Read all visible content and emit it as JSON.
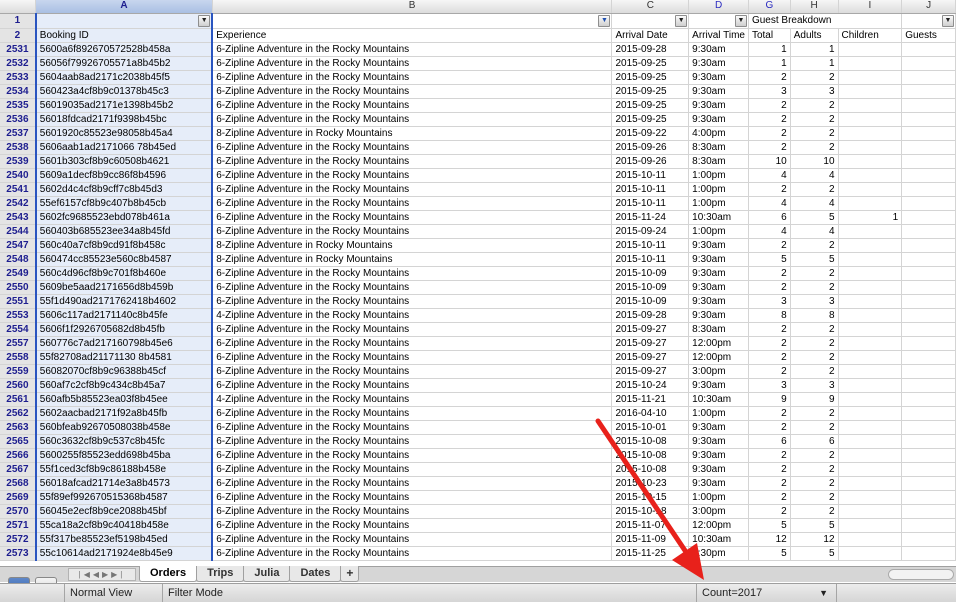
{
  "columns": {
    "row_header_top": "",
    "letters": [
      "A",
      "B",
      "C",
      "D",
      "G",
      "H",
      "I",
      "J"
    ],
    "row1_group": "Guest Breakdown",
    "headers": [
      "Booking ID",
      "Experience",
      "Arrival Date",
      "Arrival Time",
      "Total",
      "Adults",
      "Children",
      "Guests"
    ]
  },
  "header_row_numbers": [
    "1",
    "2"
  ],
  "rows": [
    [
      "2531",
      "5600a6f892670572528b458a",
      "6-Zipline Adventure in the Rocky Mountains",
      "2015-09-28",
      "9:30am",
      "1",
      "1",
      ""
    ],
    [
      "2532",
      "56056f79926705571a8b45b2",
      "6-Zipline Adventure in the Rocky Mountains",
      "2015-09-25",
      "9:30am",
      "1",
      "1",
      ""
    ],
    [
      "2533",
      "5604aab8ad2171c2038b45f5",
      "6-Zipline Adventure in the Rocky Mountains",
      "2015-09-25",
      "9:30am",
      "2",
      "2",
      ""
    ],
    [
      "2534",
      "560423a4cf8b9c01378b45c3",
      "6-Zipline Adventure in the Rocky Mountains",
      "2015-09-25",
      "9:30am",
      "3",
      "3",
      ""
    ],
    [
      "2535",
      "56019035ad2171e1398b45b2",
      "6-Zipline Adventure in the Rocky Mountains",
      "2015-09-25",
      "9:30am",
      "2",
      "2",
      ""
    ],
    [
      "2536",
      "56018fdcad2171f9398b45bc",
      "6-Zipline Adventure in the Rocky Mountains",
      "2015-09-25",
      "9:30am",
      "2",
      "2",
      ""
    ],
    [
      "2537",
      "5601920c85523e98058b45a4",
      "8-Zipline Adventure in Rocky Mountains",
      "2015-09-22",
      "4:00pm",
      "2",
      "2",
      ""
    ],
    [
      "2538",
      "5606aab1ad2171066 78b45ed",
      "6-Zipline Adventure in the Rocky Mountains",
      "2015-09-26",
      "8:30am",
      "2",
      "2",
      ""
    ],
    [
      "2539",
      "5601b303cf8b9c60508b4621",
      "6-Zipline Adventure in the Rocky Mountains",
      "2015-09-26",
      "8:30am",
      "10",
      "10",
      ""
    ],
    [
      "2540",
      "5609a1decf8b9cc86f8b4596",
      "6-Zipline Adventure in the Rocky Mountains",
      "2015-10-11",
      "1:00pm",
      "4",
      "4",
      ""
    ],
    [
      "2541",
      "5602d4c4cf8b9cff7c8b45d3",
      "6-Zipline Adventure in the Rocky Mountains",
      "2015-10-11",
      "1:00pm",
      "2",
      "2",
      ""
    ],
    [
      "2542",
      "55ef6157cf8b9c407b8b45cb",
      "6-Zipline Adventure in the Rocky Mountains",
      "2015-10-11",
      "1:00pm",
      "4",
      "4",
      ""
    ],
    [
      "2543",
      "5602fc9685523ebd078b461a",
      "6-Zipline Adventure in the Rocky Mountains",
      "2015-11-24",
      "10:30am",
      "6",
      "5",
      "1"
    ],
    [
      "2544",
      "560403b685523ee34a8b45fd",
      "6-Zipline Adventure in the Rocky Mountains",
      "2015-09-24",
      "1:00pm",
      "4",
      "4",
      ""
    ],
    [
      "2547",
      "560c40a7cf8b9cd91f8b458c",
      "8-Zipline Adventure in Rocky Mountains",
      "2015-10-11",
      "9:30am",
      "2",
      "2",
      ""
    ],
    [
      "2548",
      "560474cc85523e560c8b4587",
      "8-Zipline Adventure in Rocky Mountains",
      "2015-10-11",
      "9:30am",
      "5",
      "5",
      ""
    ],
    [
      "2549",
      "560c4d96cf8b9c701f8b460e",
      "6-Zipline Adventure in the Rocky Mountains",
      "2015-10-09",
      "9:30am",
      "2",
      "2",
      ""
    ],
    [
      "2550",
      "5609be5aad2171656d8b459b",
      "6-Zipline Adventure in the Rocky Mountains",
      "2015-10-09",
      "9:30am",
      "2",
      "2",
      ""
    ],
    [
      "2551",
      "55f1d490ad2171762418b4602",
      "6-Zipline Adventure in the Rocky Mountains",
      "2015-10-09",
      "9:30am",
      "3",
      "3",
      ""
    ],
    [
      "2553",
      "5606c117ad2171140c8b45fe",
      "4-Zipline Adventure in the Rocky Mountains",
      "2015-09-28",
      "9:30am",
      "8",
      "8",
      ""
    ],
    [
      "2554",
      "5606f1f2926705682d8b45fb",
      "6-Zipline Adventure in the Rocky Mountains",
      "2015-09-27",
      "8:30am",
      "2",
      "2",
      ""
    ],
    [
      "2557",
      "560776c7ad217160798b45e6",
      "6-Zipline Adventure in the Rocky Mountains",
      "2015-09-27",
      "12:00pm",
      "2",
      "2",
      ""
    ],
    [
      "2558",
      "55f82708ad21171130 8b4581",
      "6-Zipline Adventure in the Rocky Mountains",
      "2015-09-27",
      "12:00pm",
      "2",
      "2",
      ""
    ],
    [
      "2559",
      "56082070cf8b9c96388b45cf",
      "6-Zipline Adventure in the Rocky Mountains",
      "2015-09-27",
      "3:00pm",
      "2",
      "2",
      ""
    ],
    [
      "2560",
      "560af7c2cf8b9c434c8b45a7",
      "6-Zipline Adventure in the Rocky Mountains",
      "2015-10-24",
      "9:30am",
      "3",
      "3",
      ""
    ],
    [
      "2561",
      "560afb5b85523ea03f8b45ee",
      "4-Zipline Adventure in the Rocky Mountains",
      "2015-11-21",
      "10:30am",
      "9",
      "9",
      ""
    ],
    [
      "2562",
      "5602aacbad2171f92a8b45fb",
      "6-Zipline Adventure in the Rocky Mountains",
      "2016-04-10",
      "1:00pm",
      "2",
      "2",
      ""
    ],
    [
      "2563",
      "560bfeab92670508038b458e",
      "6-Zipline Adventure in the Rocky Mountains",
      "2015-10-01",
      "9:30am",
      "2",
      "2",
      ""
    ],
    [
      "2565",
      "560c3632cf8b9c537c8b45fc",
      "6-Zipline Adventure in the Rocky Mountains",
      "2015-10-08",
      "9:30am",
      "6",
      "6",
      ""
    ],
    [
      "2566",
      "5600255f85523edd698b45ba",
      "6-Zipline Adventure in the Rocky Mountains",
      "2015-10-08",
      "9:30am",
      "2",
      "2",
      ""
    ],
    [
      "2567",
      "55f1ced3cf8b9c86188b458e",
      "6-Zipline Adventure in the Rocky Mountains",
      "2015-10-08",
      "9:30am",
      "2",
      "2",
      ""
    ],
    [
      "2568",
      "56018afcad21714e3a8b4573",
      "6-Zipline Adventure in the Rocky Mountains",
      "2015-10-23",
      "9:30am",
      "2",
      "2",
      ""
    ],
    [
      "2569",
      "55f89ef992670515368b4587",
      "6-Zipline Adventure in the Rocky Mountains",
      "2015-10-15",
      "1:00pm",
      "2",
      "2",
      ""
    ],
    [
      "2570",
      "56045e2ecf8b9ce2088b45bf",
      "6-Zipline Adventure in the Rocky Mountains",
      "2015-10-18",
      "3:00pm",
      "2",
      "2",
      ""
    ],
    [
      "2571",
      "55ca18a2cf8b9c40418b458e",
      "6-Zipline Adventure in the Rocky Mountains",
      "2015-11-07",
      "12:00pm",
      "5",
      "5",
      ""
    ],
    [
      "2572",
      "55f317be85523ef5198b45ed",
      "6-Zipline Adventure in the Rocky Mountains",
      "2015-11-09",
      "10:30am",
      "12",
      "12",
      ""
    ],
    [
      "2573",
      "55c10614ad2171924e8b45e9",
      "6-Zipline Adventure in the Rocky Mountains",
      "2015-11-25",
      "1:30pm",
      "5",
      "5",
      ""
    ]
  ],
  "tabs": [
    {
      "label": "Orders",
      "active": true
    },
    {
      "label": "Trips",
      "active": false
    },
    {
      "label": "Julia",
      "active": false
    },
    {
      "label": "Dates",
      "active": false
    }
  ],
  "add_tab_label": "+",
  "status": {
    "view": "Normal View",
    "mode": "Filter Mode",
    "summary": "Count=2017"
  },
  "icons": {
    "normal_view": "grid-view-icon",
    "page_layout": "page-layout-icon",
    "filter_funnel": "funnel-icon",
    "arrow": "annotation-arrow-icon"
  },
  "colors": {
    "selection": "#2a55c0",
    "annotation_arrow": "#e8211b",
    "row_header_text": "#1e1e8f"
  }
}
